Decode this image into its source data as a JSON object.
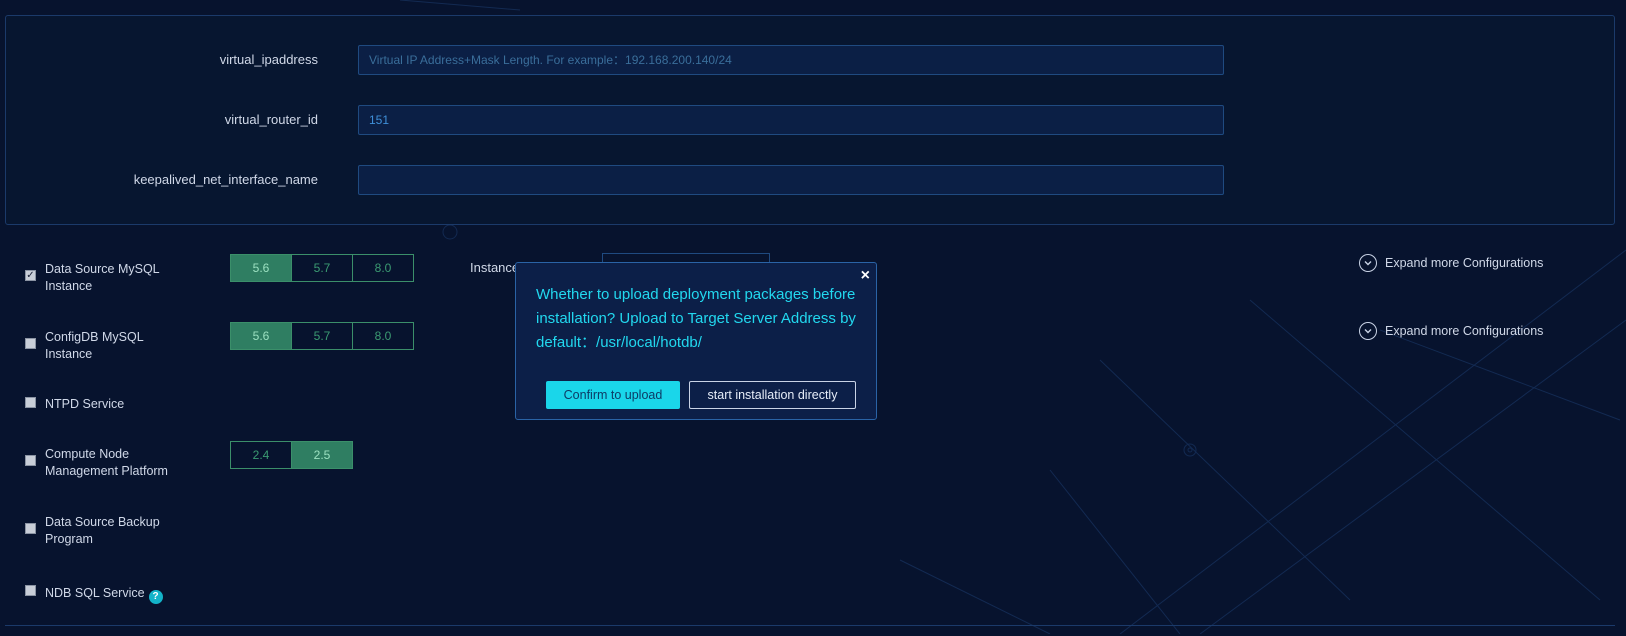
{
  "form": {
    "virtual_ipaddress": {
      "label": "virtual_ipaddress",
      "value": "",
      "placeholder": "Virtual IP Address+Mask Length. For example：192.168.200.140/24"
    },
    "virtual_router_id": {
      "label": "virtual_router_id",
      "value": "151"
    },
    "keepalived_net_interface_name": {
      "label": "keepalived_net_interface_name",
      "value": ""
    }
  },
  "services": [
    {
      "label": "Data Source MySQL Instance",
      "checked": true,
      "versions": [
        "5.6",
        "5.7",
        "8.0"
      ],
      "active": "5.6"
    },
    {
      "label": "ConfigDB MySQL Instance",
      "checked": false,
      "versions": [
        "5.6",
        "5.7",
        "8.0"
      ],
      "active": "5.6"
    },
    {
      "label": "NTPD Service",
      "checked": false
    },
    {
      "label": "Compute Node Management Platform",
      "checked": false,
      "versions": [
        "2.4",
        "2.5"
      ],
      "active": "2.5"
    },
    {
      "label": "Data Source Backup Program",
      "checked": false
    },
    {
      "label": "NDB SQL Service",
      "checked": false
    }
  ],
  "instance_label": "Instance",
  "expand_label": "Expand more Configurations",
  "dialog": {
    "message": "Whether to upload deployment packages before installation? Upload to Target Server Address by default：/usr/local/hotdb/",
    "confirm_label": "Confirm to upload",
    "direct_label": "start installation directly",
    "close_glyph": "×"
  },
  "checkmark_glyph": "✓",
  "help_glyph": "?",
  "chevron_glyph": "⌄"
}
